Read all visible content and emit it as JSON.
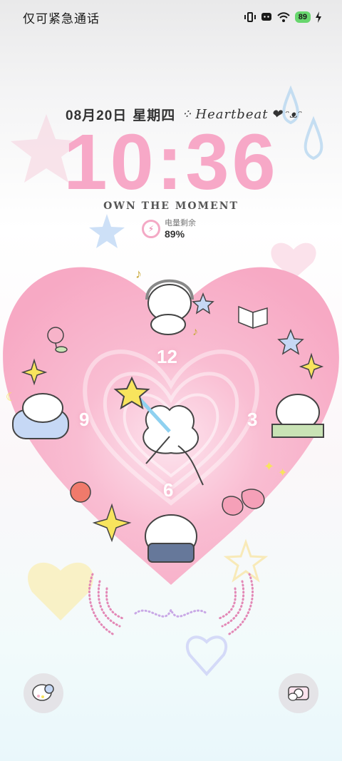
{
  "status_bar": {
    "carrier_text": "仅可紧急通话",
    "battery_level": "89",
    "icons": [
      "vibrate-icon",
      "message-icon",
      "wifi-icon",
      "battery-icon",
      "charging-icon"
    ]
  },
  "lockscreen": {
    "date": "08月20日",
    "weekday": "星期四",
    "tagline_script": "Heartbeat",
    "time": "10:36",
    "motto": "OWN THE MOMENT",
    "battery_widget": {
      "label": "电量剩余",
      "value": "89%"
    },
    "clock_numbers": {
      "twelve": "12",
      "three": "3",
      "six": "6",
      "nine": "9"
    }
  },
  "shortcuts": {
    "left_icon": "theme-icon",
    "right_icon": "camera-icon"
  },
  "colors": {
    "accent_pink": "#f7a8c7",
    "heart_pink": "#f9b6cc",
    "battery_green": "#67d66d"
  }
}
